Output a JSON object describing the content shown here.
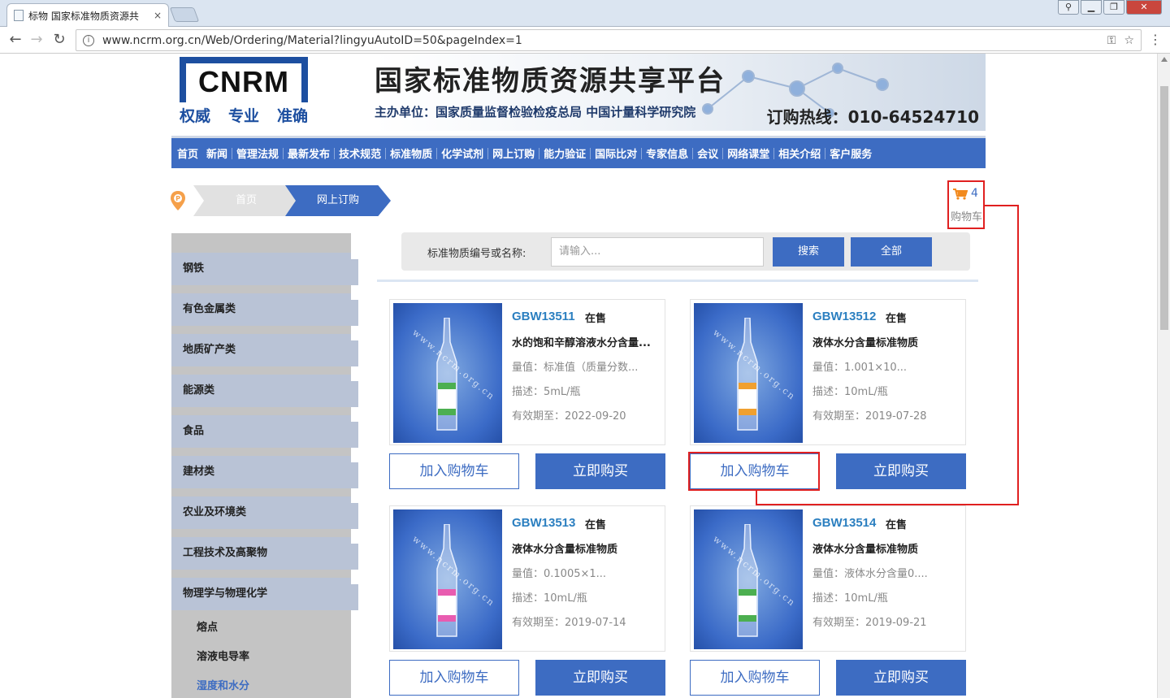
{
  "browser": {
    "tab_title": "标物 国家标准物质资源共",
    "tab_close": "×",
    "url": "www.ncrm.org.cn/Web/Ordering/Material?lingyuAutoID=50&pageIndex=1",
    "info_icon": "i",
    "window_controls": [
      "user-icon",
      "minimize-icon",
      "restore-icon",
      "close-icon"
    ]
  },
  "header": {
    "logo_text": "CNRM",
    "slogan": [
      "权威",
      "专业",
      "准确"
    ],
    "site_title": "国家标准物质资源共享平台",
    "host": "主办单位：国家质量监督检验检疫总局 中国计量科学研究院",
    "hotline": "订购热线：010-64524710"
  },
  "nav": [
    "首页",
    "新闻",
    "管理法规",
    "最新发布",
    "技术规范",
    "标准物质",
    "化学试剂",
    "网上订购",
    "能力验证",
    "国际比对",
    "专家信息",
    "会议",
    "网络课堂",
    "相关介绍",
    "客户服务"
  ],
  "breadcrumb": {
    "home": "首页",
    "current": "网上订购"
  },
  "cart": {
    "count": "4",
    "label": "购物车"
  },
  "sidebar": {
    "categories": [
      "钢铁",
      "有色金属类",
      "地质矿产类",
      "能源类",
      "食品",
      "建材类",
      "农业及环境类",
      "工程技术及高聚物",
      "物理学与物理化学"
    ],
    "subitems": [
      "熔点",
      "溶液电导率",
      "湿度和水分"
    ],
    "active_sub": "湿度和水分"
  },
  "search": {
    "label": "标准物质编号或名称:",
    "placeholder": "请输入...",
    "search_btn": "搜索",
    "all_btn": "全部"
  },
  "products": [
    {
      "code": "GBW13511",
      "status": "在售",
      "name": "水的饱和辛醇溶液水分含量...",
      "value": "量值：标准值（质量分数...",
      "desc": "描述：5mL/瓶",
      "expiry": "有效期至：2022-09-20",
      "label_color": "#4caf50",
      "watermark": "www.ncrm.org.cn"
    },
    {
      "code": "GBW13512",
      "status": "在售",
      "name": "液体水分含量标准物质",
      "value": "量值：1.001×10...",
      "desc": "描述：10mL/瓶",
      "expiry": "有效期至：2019-07-28",
      "label_color": "#f0a030",
      "watermark": "www.ncrm.org.cn"
    },
    {
      "code": "GBW13513",
      "status": "在售",
      "name": "液体水分含量标准物质",
      "value": "量值：0.1005×1...",
      "desc": "描述：10mL/瓶",
      "expiry": "有效期至：2019-07-14",
      "label_color": "#e85cb0",
      "watermark": "www.ncrm.org.cn"
    },
    {
      "code": "GBW13514",
      "status": "在售",
      "name": "液体水分含量标准物质",
      "value": "量值：液体水分含量0....",
      "desc": "描述：10mL/瓶",
      "expiry": "有效期至：2019-09-21",
      "label_color": "#4caf50",
      "watermark": "www.ncrm.org.cn"
    }
  ],
  "buttons": {
    "add_to_cart": "加入购物车",
    "buy_now": "立即购买"
  },
  "colors": {
    "primary": "#3d6cc2",
    "annotation": "#e02020",
    "code_link": "#2b7fc0"
  }
}
